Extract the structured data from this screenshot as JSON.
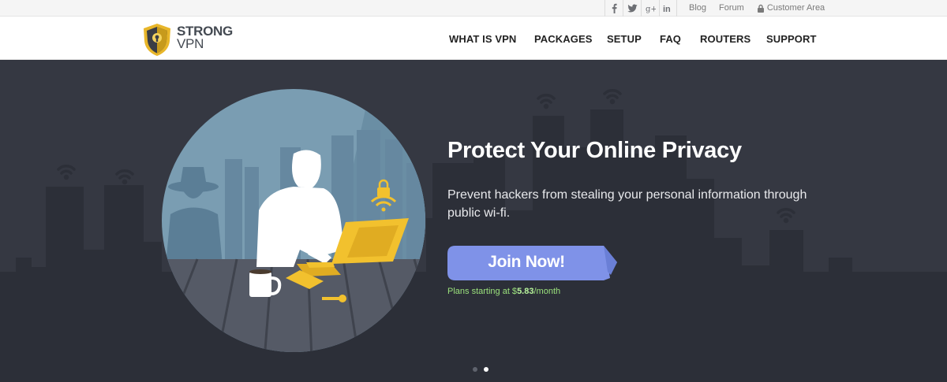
{
  "topbar": {
    "social": [
      {
        "icon": "facebook-icon",
        "name": "Facebook"
      },
      {
        "icon": "twitter-icon",
        "name": "Twitter"
      },
      {
        "icon": "google-plus-icon",
        "name": "Google+"
      },
      {
        "icon": "linkedin-icon",
        "name": "LinkedIn"
      }
    ],
    "links": {
      "blog": "Blog",
      "forum": "Forum",
      "customer_area": "Customer Area"
    }
  },
  "logo": {
    "line1": "STRONG",
    "line2": "VPN"
  },
  "nav": {
    "items": [
      "WHAT IS VPN",
      "PACKAGES",
      "SETUP",
      "FAQ",
      "ROUTERS",
      "SUPPORT"
    ]
  },
  "hero": {
    "headline": "Protect Your Online Privacy",
    "subtext": "Prevent hackers from stealing your personal information through public wi-fi.",
    "cta": "Join Now!",
    "plans_prefix": "Plans starting at $",
    "plans_price": "5.83",
    "plans_suffix": "/month"
  },
  "slider": {
    "active_index": 1,
    "count": 2
  },
  "colors": {
    "hero_bg": "#353842",
    "skyline": "#2b2e37",
    "button": "#7f92e8",
    "price": "#9be27c",
    "accent_yellow": "#f2c12e"
  }
}
